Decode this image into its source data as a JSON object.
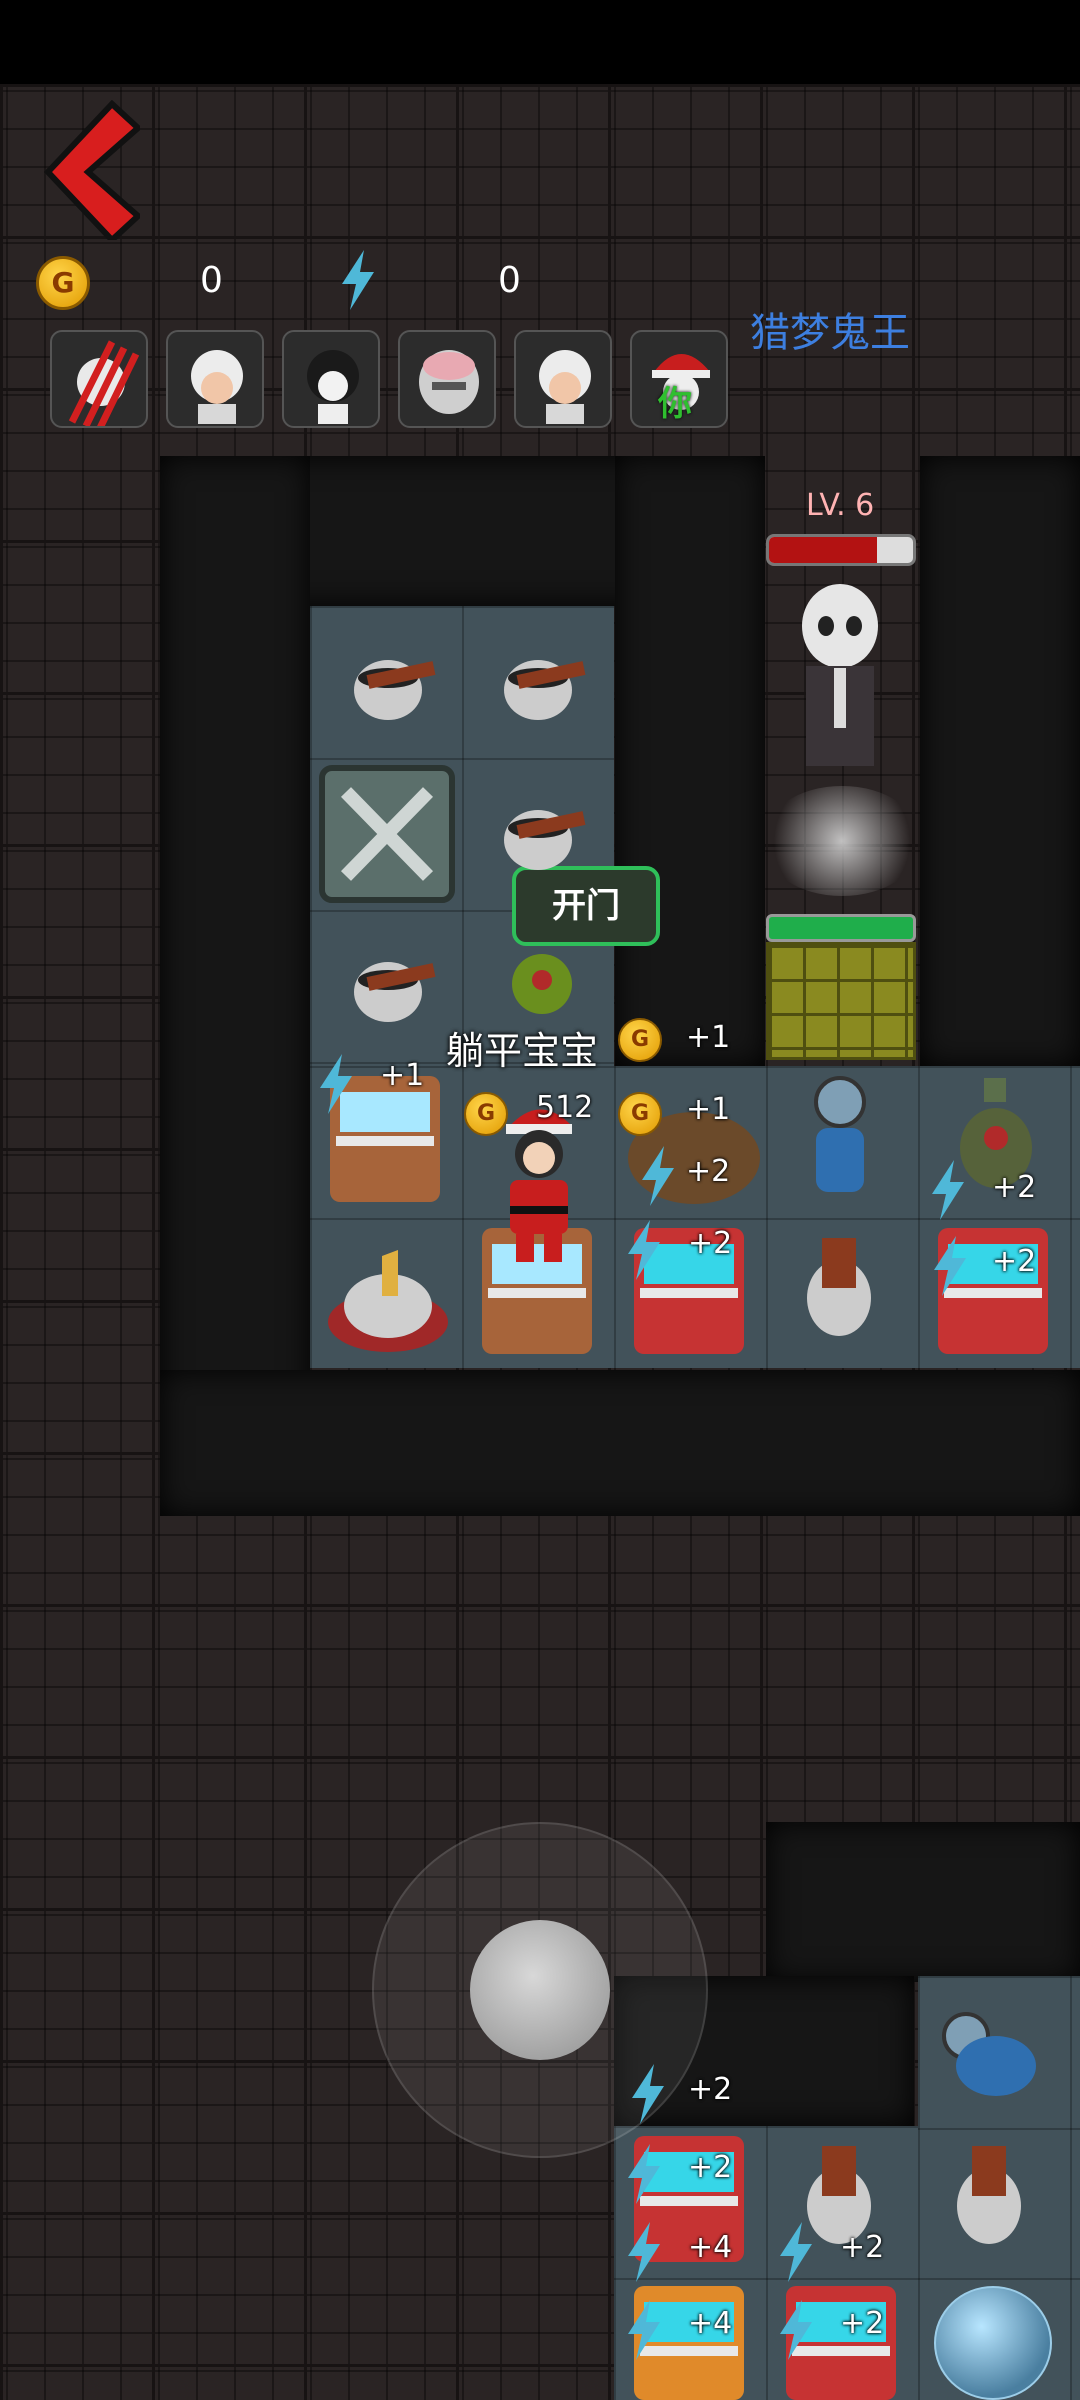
{
  "hud": {
    "coins": "0",
    "energy": "0",
    "coin_symbol": "G"
  },
  "roster": {
    "avatars": [
      "clawed-ghost-avatar",
      "grandma-avatar",
      "girl-avatar",
      "pig-mask-avatar",
      "grandma-avatar-2",
      "santa-player-avatar"
    ],
    "self_label": "你"
  },
  "enemy": {
    "name": "猎梦鬼王",
    "level": "LV. 6",
    "hp_fraction": 0.75
  },
  "room": {
    "door_button": "开门",
    "door_hp_fraction": 1.0
  },
  "player": {
    "name": "躺平宝宝",
    "coin_gain": "+1",
    "coin_gain_2": "+1",
    "counter_a": "512",
    "counter_b": "512"
  },
  "labels": {
    "plus1": "+1",
    "plus2": "+2",
    "plus4": "+4"
  },
  "colors": {
    "accent_red": "#d81e1e",
    "name_blue": "#3d7fe0",
    "door_green": "#1fae4b"
  }
}
